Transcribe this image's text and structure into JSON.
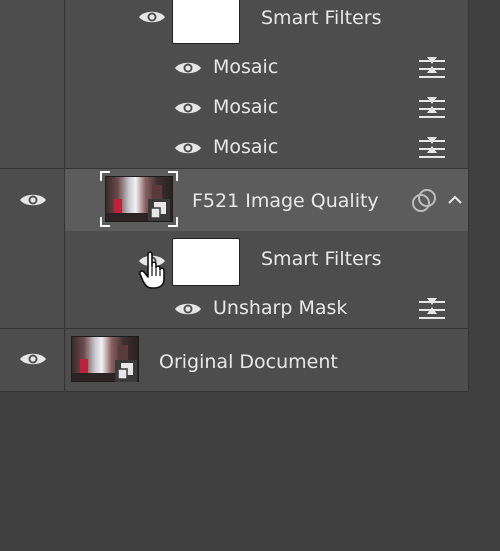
{
  "layers": {
    "top_group": {
      "smart_filters_label": "Smart Filters",
      "filters": [
        {
          "label": "Mosaic"
        },
        {
          "label": "Mosaic"
        },
        {
          "label": "Mosaic"
        }
      ]
    },
    "f521": {
      "name": "F521 Image Quality",
      "smart_filters_label": "Smart Filters",
      "filters": [
        {
          "label": "Unsharp Mask"
        }
      ]
    },
    "original": {
      "name": "Original Document"
    }
  },
  "icons": {
    "eye": "eye-icon",
    "filter_options": "filter-options-icon",
    "smart_object": "smart-object-icon",
    "linked": "linked-circles-icon",
    "collapse": "chevron-up-icon",
    "cursor": "hand-pointer-icon"
  },
  "colors": {
    "panel_bg": "#3f3f3f",
    "row_bg": "#4d4d4d",
    "selected_row_bg": "#5c5c5c",
    "text": "#e8e8e8"
  }
}
